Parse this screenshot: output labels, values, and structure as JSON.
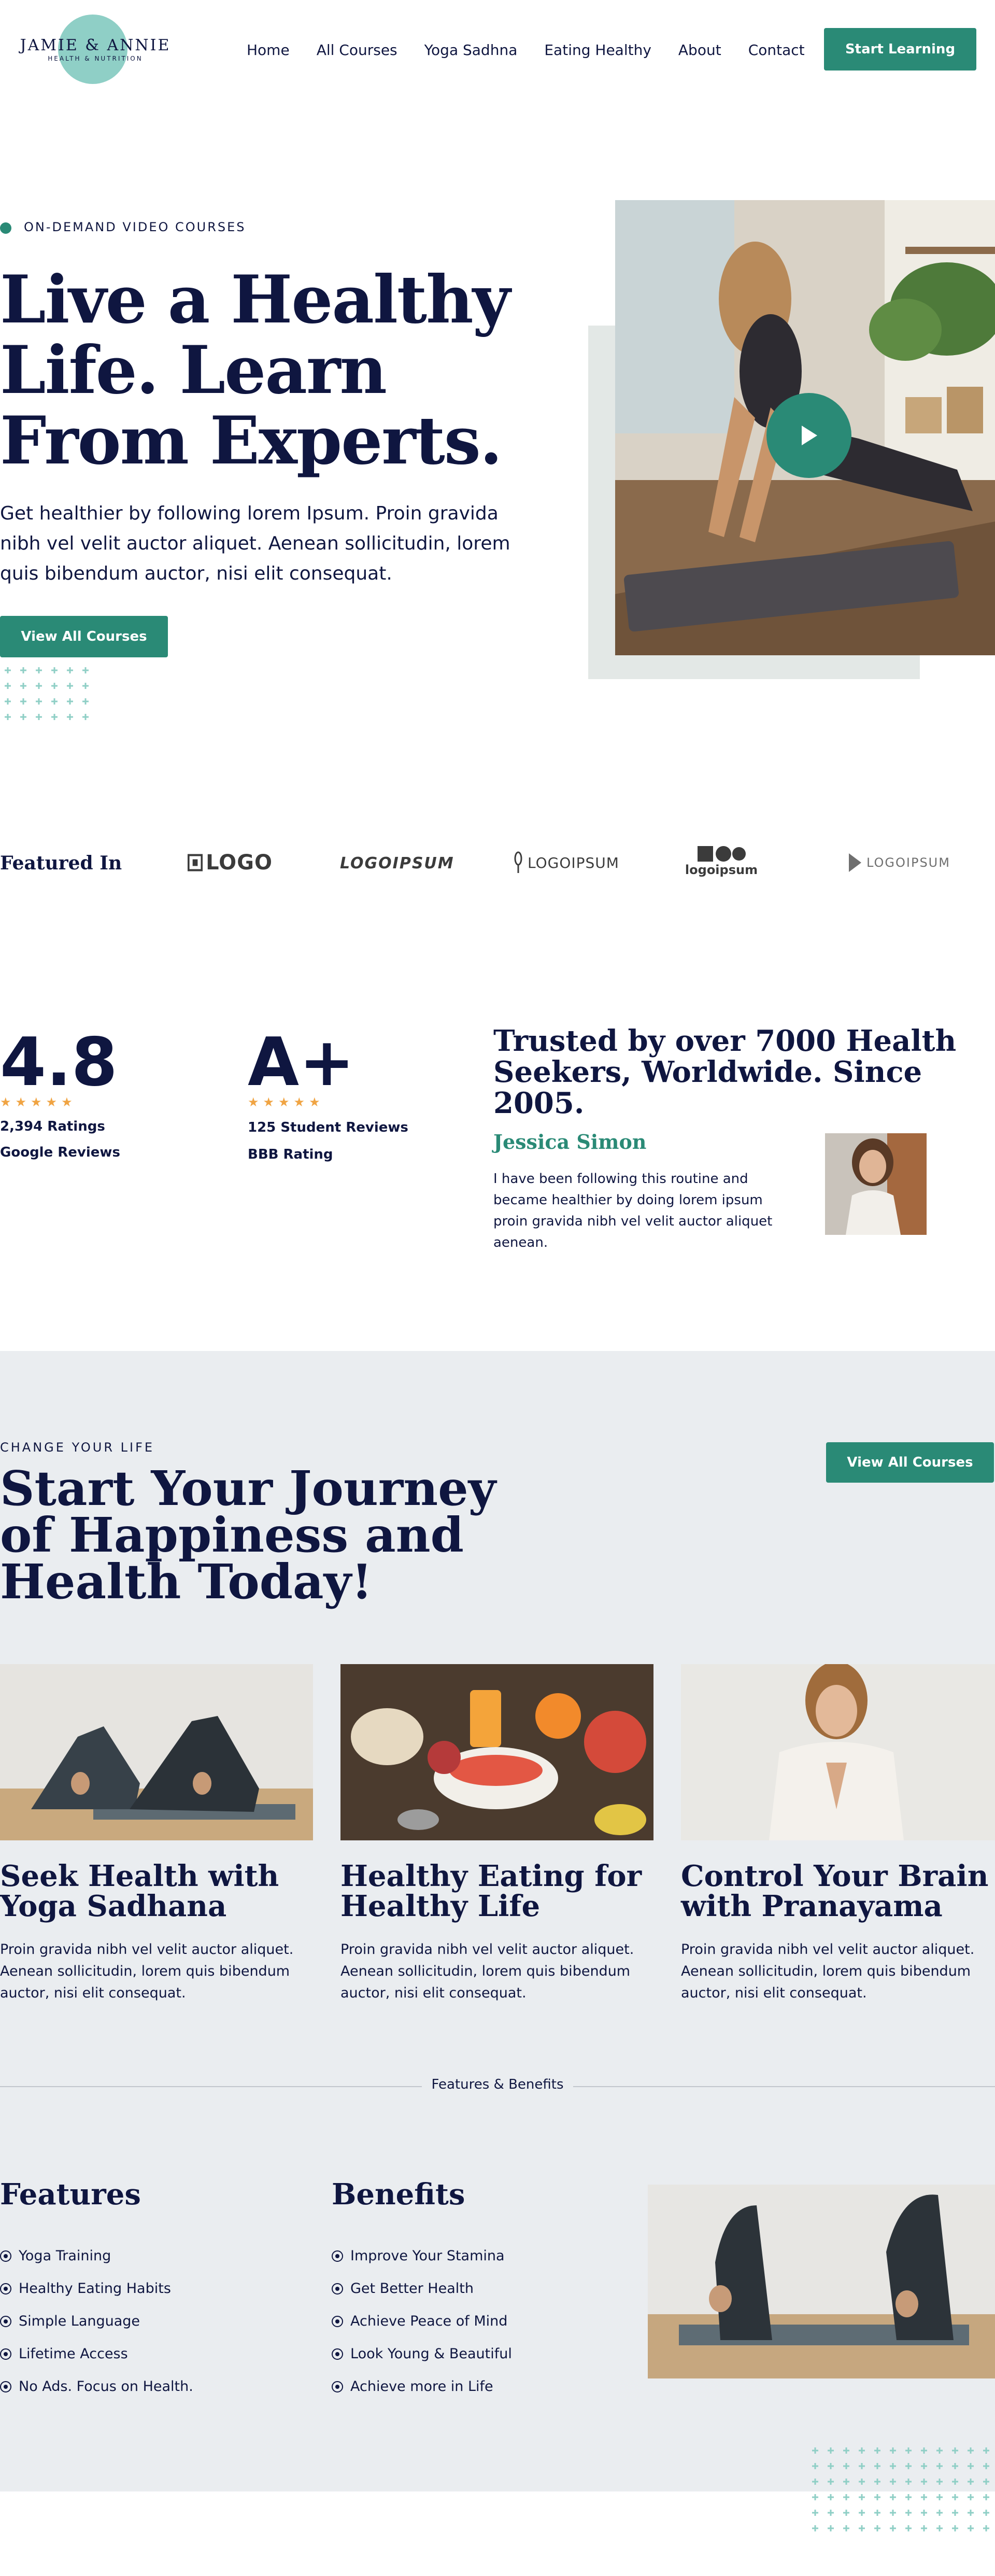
{
  "brand": {
    "name": "JAMIE & ANNIE",
    "tagline": "HEALTH & NUTRITION"
  },
  "nav": {
    "items": [
      "Home",
      "All Courses",
      "Yoga Sadhna",
      "Eating Healthy",
      "About",
      "Contact"
    ],
    "cta": "Start Learning"
  },
  "hero": {
    "eyebrow": "ON-DEMAND VIDEO COURSES",
    "title": "Live a Healthy Life. Learn From Experts.",
    "text": "Get healthier by following lorem Ipsum. Proin gravida nibh vel velit auctor aliquet. Aenean sollicitudin, lorem quis bibendum auctor, nisi elit consequat.",
    "button": "View All Courses"
  },
  "featured": {
    "label": "Featured In",
    "logos": [
      "LOGO",
      "LOGOIPSUM",
      "LOGOIPSUM",
      "logoipsum",
      "LOGOIPSUM"
    ]
  },
  "stats": {
    "rating": {
      "value": "4.8",
      "count": "2,394 Ratings",
      "source": "Google Reviews"
    },
    "grade": {
      "value": "A+",
      "count": "125 Student Reviews",
      "source": "BBB Rating"
    },
    "star_count": 5,
    "trusted_title": "Trusted by over 7000 Health Seekers, Worldwide. Since 2005.",
    "testimonial": {
      "name": "Jessica Simon",
      "text": "I have been following this routine and became healthier by doing lorem ipsum proin gravida nibh vel velit auctor aliquet aenean."
    }
  },
  "journey": {
    "eyebrow": "CHANGE YOUR LIFE",
    "title": "Start Your Journey of Happiness and Health Today!",
    "button": "View All Courses",
    "cards": [
      {
        "title": "Seek Health with Yoga Sadhana",
        "text": "Proin gravida nibh vel velit auctor aliquet. Aenean sollicitudin, lorem quis bibendum auctor, nisi elit consequat."
      },
      {
        "title": "Healthy Eating for Healthy Life",
        "text": "Proin gravida nibh vel velit auctor aliquet. Aenean sollicitudin, lorem quis bibendum auctor, nisi elit consequat."
      },
      {
        "title": "Control Your Brain with Pranayama",
        "text": "Proin gravida nibh vel velit auctor aliquet. Aenean sollicitudin, lorem quis bibendum auctor, nisi elit consequat."
      }
    ]
  },
  "features_benefits": {
    "divider_label": "Features & Benefits",
    "features": {
      "title": "Features",
      "items": [
        "Yoga Training",
        "Healthy Eating Habits",
        "Simple Language",
        "Lifetime Access",
        "No Ads. Focus on Health."
      ]
    },
    "benefits": {
      "title": "Benefits",
      "items": [
        "Improve Your Stamina",
        "Get Better Health",
        "Achieve Peace of Mind",
        "Look Young & Beautiful",
        "Achieve more in Life"
      ]
    }
  },
  "colors": {
    "accent": "#2a8a76",
    "navy": "#0f1640",
    "star": "#f0a443",
    "section_bg": "#eaedf0"
  }
}
